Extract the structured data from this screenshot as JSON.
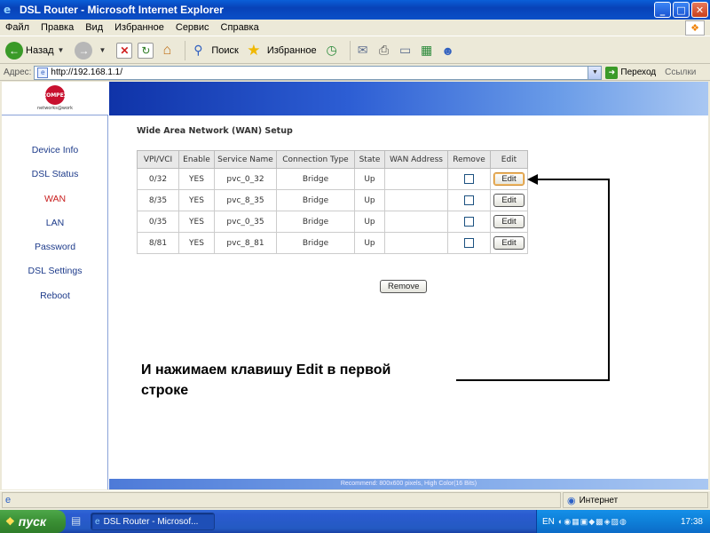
{
  "window": {
    "title": "DSL Router - Microsoft Internet Explorer",
    "minimize": "_",
    "maximize": "□",
    "close": "✕"
  },
  "menubar": [
    "Файл",
    "Правка",
    "Вид",
    "Избранное",
    "Сервис",
    "Справка"
  ],
  "toolbar": {
    "back_label": "Назад",
    "search_label": "Поиск",
    "favorites_label": "Избранное"
  },
  "address": {
    "label": "Адрес:",
    "url": "http://192.168.1.1/",
    "go_label": "Переход",
    "links_label": "Ссылки"
  },
  "router": {
    "logo_text": "COMPEX",
    "logo_tagline": "networks@work",
    "nav": [
      "Device Info",
      "DSL Status",
      "WAN",
      "LAN",
      "Password",
      "DSL Settings",
      "Reboot"
    ],
    "active_nav": "WAN",
    "heading": "Wide Area Network (WAN) Setup",
    "table": {
      "columns": [
        "VPI/VCI",
        "Enable",
        "Service Name",
        "Connection Type",
        "State",
        "WAN Address",
        "Remove",
        "Edit"
      ],
      "rows": [
        {
          "vpivci": "0/32",
          "enable": "YES",
          "service": "pvc_0_32",
          "type": "Bridge",
          "state": "Up",
          "wan": "",
          "edit": "Edit"
        },
        {
          "vpivci": "8/35",
          "enable": "YES",
          "service": "pvc_8_35",
          "type": "Bridge",
          "state": "Up",
          "wan": "",
          "edit": "Edit"
        },
        {
          "vpivci": "0/35",
          "enable": "YES",
          "service": "pvc_0_35",
          "type": "Bridge",
          "state": "Up",
          "wan": "",
          "edit": "Edit"
        },
        {
          "vpivci": "8/81",
          "enable": "YES",
          "service": "pvc_8_81",
          "type": "Bridge",
          "state": "Up",
          "wan": "",
          "edit": "Edit"
        }
      ]
    },
    "remove_button": "Remove",
    "footer": "Recommend: 800x600 pixels, High Color(16 Bits)"
  },
  "annotation": {
    "line1": "И нажимаем клавишу Edit в первой",
    "line2": "строке"
  },
  "statusbar": {
    "zone": "Интернет"
  },
  "taskbar": {
    "start_label": "пуск",
    "task_label": "DSL Router - Microsof...",
    "lang": "EN",
    "clock": "17:38"
  },
  "colors": {
    "accent": "#0a4fc8",
    "nav_active": "#c81e1e",
    "nav_link": "#1c3a8a"
  }
}
